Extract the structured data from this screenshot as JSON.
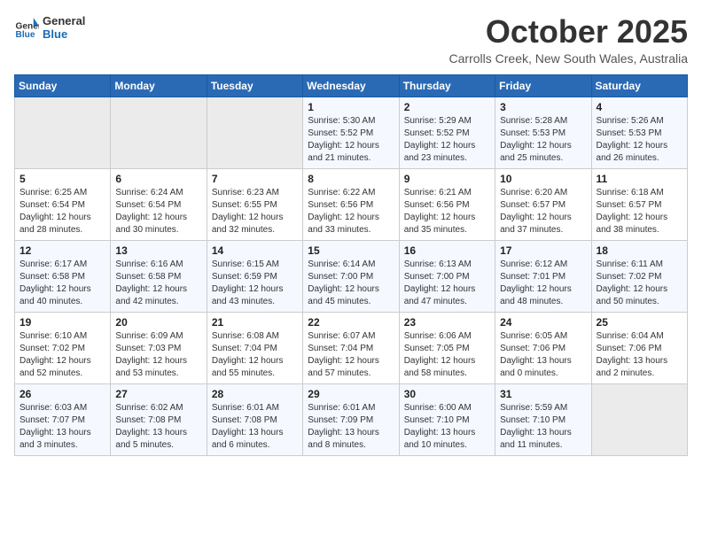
{
  "logo": {
    "line1": "General",
    "line2": "Blue"
  },
  "title": "October 2025",
  "subtitle": "Carrolls Creek, New South Wales, Australia",
  "days_of_week": [
    "Sunday",
    "Monday",
    "Tuesday",
    "Wednesday",
    "Thursday",
    "Friday",
    "Saturday"
  ],
  "weeks": [
    [
      {
        "day": "",
        "info": ""
      },
      {
        "day": "",
        "info": ""
      },
      {
        "day": "",
        "info": ""
      },
      {
        "day": "1",
        "info": "Sunrise: 5:30 AM\nSunset: 5:52 PM\nDaylight: 12 hours\nand 21 minutes."
      },
      {
        "day": "2",
        "info": "Sunrise: 5:29 AM\nSunset: 5:52 PM\nDaylight: 12 hours\nand 23 minutes."
      },
      {
        "day": "3",
        "info": "Sunrise: 5:28 AM\nSunset: 5:53 PM\nDaylight: 12 hours\nand 25 minutes."
      },
      {
        "day": "4",
        "info": "Sunrise: 5:26 AM\nSunset: 5:53 PM\nDaylight: 12 hours\nand 26 minutes."
      }
    ],
    [
      {
        "day": "5",
        "info": "Sunrise: 6:25 AM\nSunset: 6:54 PM\nDaylight: 12 hours\nand 28 minutes."
      },
      {
        "day": "6",
        "info": "Sunrise: 6:24 AM\nSunset: 6:54 PM\nDaylight: 12 hours\nand 30 minutes."
      },
      {
        "day": "7",
        "info": "Sunrise: 6:23 AM\nSunset: 6:55 PM\nDaylight: 12 hours\nand 32 minutes."
      },
      {
        "day": "8",
        "info": "Sunrise: 6:22 AM\nSunset: 6:56 PM\nDaylight: 12 hours\nand 33 minutes."
      },
      {
        "day": "9",
        "info": "Sunrise: 6:21 AM\nSunset: 6:56 PM\nDaylight: 12 hours\nand 35 minutes."
      },
      {
        "day": "10",
        "info": "Sunrise: 6:20 AM\nSunset: 6:57 PM\nDaylight: 12 hours\nand 37 minutes."
      },
      {
        "day": "11",
        "info": "Sunrise: 6:18 AM\nSunset: 6:57 PM\nDaylight: 12 hours\nand 38 minutes."
      }
    ],
    [
      {
        "day": "12",
        "info": "Sunrise: 6:17 AM\nSunset: 6:58 PM\nDaylight: 12 hours\nand 40 minutes."
      },
      {
        "day": "13",
        "info": "Sunrise: 6:16 AM\nSunset: 6:58 PM\nDaylight: 12 hours\nand 42 minutes."
      },
      {
        "day": "14",
        "info": "Sunrise: 6:15 AM\nSunset: 6:59 PM\nDaylight: 12 hours\nand 43 minutes."
      },
      {
        "day": "15",
        "info": "Sunrise: 6:14 AM\nSunset: 7:00 PM\nDaylight: 12 hours\nand 45 minutes."
      },
      {
        "day": "16",
        "info": "Sunrise: 6:13 AM\nSunset: 7:00 PM\nDaylight: 12 hours\nand 47 minutes."
      },
      {
        "day": "17",
        "info": "Sunrise: 6:12 AM\nSunset: 7:01 PM\nDaylight: 12 hours\nand 48 minutes."
      },
      {
        "day": "18",
        "info": "Sunrise: 6:11 AM\nSunset: 7:02 PM\nDaylight: 12 hours\nand 50 minutes."
      }
    ],
    [
      {
        "day": "19",
        "info": "Sunrise: 6:10 AM\nSunset: 7:02 PM\nDaylight: 12 hours\nand 52 minutes."
      },
      {
        "day": "20",
        "info": "Sunrise: 6:09 AM\nSunset: 7:03 PM\nDaylight: 12 hours\nand 53 minutes."
      },
      {
        "day": "21",
        "info": "Sunrise: 6:08 AM\nSunset: 7:04 PM\nDaylight: 12 hours\nand 55 minutes."
      },
      {
        "day": "22",
        "info": "Sunrise: 6:07 AM\nSunset: 7:04 PM\nDaylight: 12 hours\nand 57 minutes."
      },
      {
        "day": "23",
        "info": "Sunrise: 6:06 AM\nSunset: 7:05 PM\nDaylight: 12 hours\nand 58 minutes."
      },
      {
        "day": "24",
        "info": "Sunrise: 6:05 AM\nSunset: 7:06 PM\nDaylight: 13 hours\nand 0 minutes."
      },
      {
        "day": "25",
        "info": "Sunrise: 6:04 AM\nSunset: 7:06 PM\nDaylight: 13 hours\nand 2 minutes."
      }
    ],
    [
      {
        "day": "26",
        "info": "Sunrise: 6:03 AM\nSunset: 7:07 PM\nDaylight: 13 hours\nand 3 minutes."
      },
      {
        "day": "27",
        "info": "Sunrise: 6:02 AM\nSunset: 7:08 PM\nDaylight: 13 hours\nand 5 minutes."
      },
      {
        "day": "28",
        "info": "Sunrise: 6:01 AM\nSunset: 7:08 PM\nDaylight: 13 hours\nand 6 minutes."
      },
      {
        "day": "29",
        "info": "Sunrise: 6:01 AM\nSunset: 7:09 PM\nDaylight: 13 hours\nand 8 minutes."
      },
      {
        "day": "30",
        "info": "Sunrise: 6:00 AM\nSunset: 7:10 PM\nDaylight: 13 hours\nand 10 minutes."
      },
      {
        "day": "31",
        "info": "Sunrise: 5:59 AM\nSunset: 7:10 PM\nDaylight: 13 hours\nand 11 minutes."
      },
      {
        "day": "",
        "info": ""
      }
    ]
  ]
}
